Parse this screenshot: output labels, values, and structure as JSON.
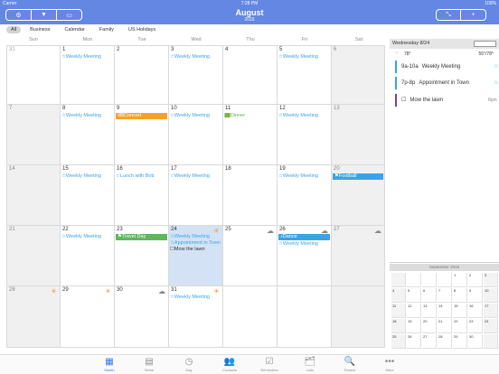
{
  "status": {
    "carrier": "Carrier",
    "time": "7:28 PM",
    "battery": "100%"
  },
  "header": {
    "title": "August",
    "year": "2016",
    "left_buttons": [
      "gear-icon",
      "filter-icon",
      "card-icon"
    ],
    "right_buttons": [
      "collapse-icon",
      "add-icon"
    ],
    "add_label": "+"
  },
  "filters": [
    "All",
    "Business",
    "Calendar",
    "Family",
    "US Holidays"
  ],
  "weekdays": [
    "Sun",
    "Mon",
    "Tue",
    "Wed",
    "Thu",
    "Fri",
    "Sat"
  ],
  "weeks": [
    [
      {
        "d": "31",
        "out": true
      },
      {
        "d": "1",
        "ev": [
          "☆Weekly Meeting"
        ]
      },
      {
        "d": "2"
      },
      {
        "d": "3",
        "ev": [
          "☆Weekly Meeting"
        ]
      },
      {
        "d": "4"
      },
      {
        "d": "5",
        "ev": [
          "☆Weekly Meeting"
        ]
      },
      {
        "d": "6",
        "we": true
      }
    ],
    [
      {
        "d": "7",
        "we": true
      },
      {
        "d": "8",
        "ev": [
          "☆Weekly Meeting"
        ]
      },
      {
        "d": "9",
        "bar": {
          "text": "🎟Concert",
          "color": "#f4a12c"
        }
      },
      {
        "d": "10",
        "ev": [
          "☆Weekly Meeting"
        ]
      },
      {
        "d": "11",
        "ev": [
          "🟩Dinner"
        ],
        "evcolor": "#5cb85c"
      },
      {
        "d": "12",
        "ev": [
          "☆Weekly Meeting"
        ]
      },
      {
        "d": "13",
        "we": true
      }
    ],
    [
      {
        "d": "14",
        "we": true
      },
      {
        "d": "15",
        "ev": [
          "☆Weekly Meeting"
        ]
      },
      {
        "d": "16",
        "ev": [
          "☆Lunch with Bob"
        ]
      },
      {
        "d": "17",
        "ev": [
          "☆Weekly Meeting"
        ]
      },
      {
        "d": "18"
      },
      {
        "d": "19",
        "ev": [
          "☆Weekly Meeting"
        ]
      },
      {
        "d": "20",
        "we": true,
        "bar": {
          "text": "⚑Football",
          "color": "#3aa3e6"
        }
      }
    ],
    [
      {
        "d": "21",
        "we": true
      },
      {
        "d": "22",
        "ev": [
          "☆Weekly Meeting"
        ]
      },
      {
        "d": "23",
        "bar": {
          "text": "⚑Travel Day",
          "color": "#5cb85c"
        }
      },
      {
        "d": "24",
        "today": true,
        "wx": "☀",
        "ev": [
          "☆Weekly Meeting",
          "☆Appointment in Town",
          "☐Mow the lawn"
        ]
      },
      {
        "d": "25",
        "wx": "☁"
      },
      {
        "d": "26",
        "wx": "☁",
        "bar": {
          "text": "♪Dance",
          "color": "#3aa3e6"
        },
        "ev": [
          "☆Weekly Meeting"
        ]
      },
      {
        "d": "27",
        "we": true,
        "wx": "☁"
      }
    ],
    [
      {
        "d": "28",
        "we": true,
        "wx": "☀"
      },
      {
        "d": "29",
        "wx": "☀"
      },
      {
        "d": "30",
        "wx": "☁"
      },
      {
        "d": "31",
        "wx": "☀",
        "ev": [
          "☆Weekly Meeting"
        ]
      },
      {
        "d": ""
      },
      {
        "d": ""
      },
      {
        "d": "",
        "we": true
      }
    ]
  ],
  "side": {
    "header": "Wednesday 8/24",
    "weather": "78°",
    "hilo": "55°/78°",
    "events": [
      {
        "time": "9a-10a",
        "title": "Weekly Meeting",
        "color": "#3aa3e6"
      },
      {
        "time": "7p-8p",
        "title": "Appointment in Town",
        "color": "#3aa3e6"
      },
      {
        "time": "☐",
        "title": "Mow the lawn",
        "color": "#7b3fa5",
        "right": "8pm"
      }
    ]
  },
  "mini": {
    "header": "September 2016",
    "days": [
      "1",
      "2",
      "3",
      "4",
      "5",
      "6",
      "7",
      "8",
      "9",
      "10",
      "11",
      "12",
      "13",
      "14",
      "15",
      "16",
      "17",
      "18",
      "19",
      "20",
      "21",
      "22",
      "23",
      "24",
      "25",
      "26",
      "27",
      "28",
      "29",
      "30"
    ]
  },
  "tabs": [
    {
      "label": "Month",
      "icon": "▦",
      "sel": true
    },
    {
      "label": "Week",
      "icon": "▤"
    },
    {
      "label": "Day",
      "icon": "◷"
    },
    {
      "label": "Contacts",
      "icon": "👥"
    },
    {
      "label": "Reminders",
      "icon": "☑"
    },
    {
      "label": "Lists",
      "icon": "🗂"
    },
    {
      "label": "Search",
      "icon": "🔍"
    },
    {
      "label": "More",
      "icon": "•••"
    }
  ]
}
